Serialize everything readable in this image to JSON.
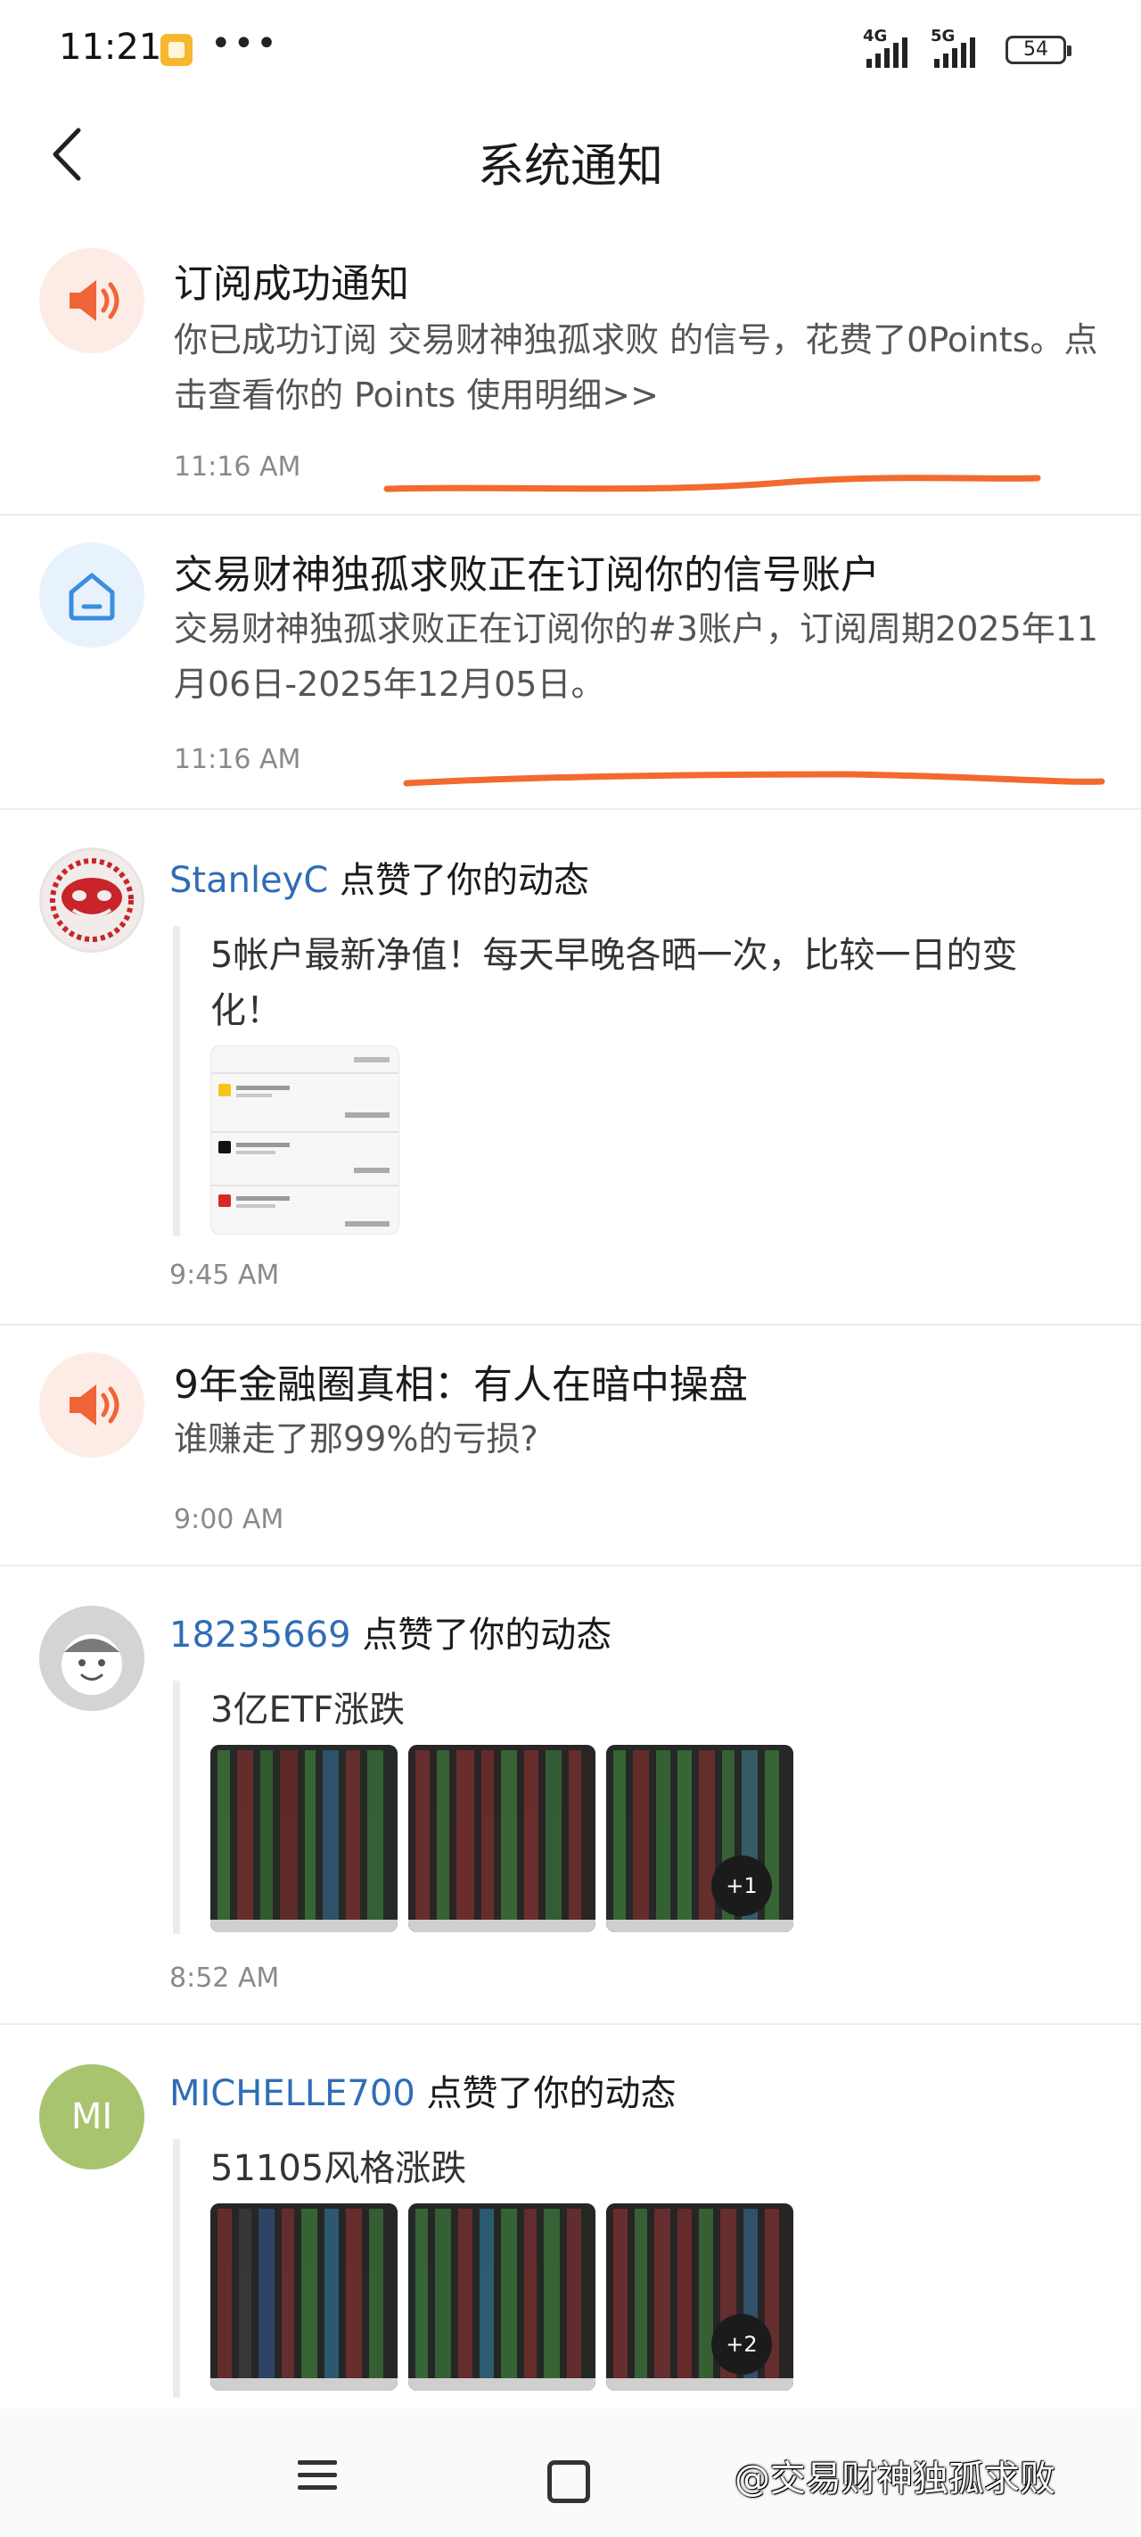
{
  "status_bar": {
    "time": "11:21",
    "dots": "•••",
    "net1": "4G",
    "net2": "5G",
    "battery": "54"
  },
  "header": {
    "title": "系统通知"
  },
  "items": [
    {
      "type": "system",
      "icon": "speaker-icon",
      "title": "订阅成功通知",
      "body": "你已成功订阅 交易财神独孤求败 的信号，花费了0Points。点击查看你的 Points 使用明细>>",
      "time": "11:16 AM"
    },
    {
      "type": "system",
      "icon": "home-icon",
      "title": "交易财神独孤求败正在订阅你的信号账户",
      "body": "交易财神独孤求败正在订阅你的#3账户，订阅周期2025年11月06日-2025年12月05日。",
      "time": "11:16 AM"
    },
    {
      "type": "like",
      "user": "StanleyC",
      "action": "点赞了你的动态",
      "quote": [
        "5帐户最新净值！每天早晚各晒一次，比较一日的变",
        "化！"
      ],
      "time": "9:45 AM"
    },
    {
      "type": "system",
      "icon": "speaker-icon",
      "title": "9年金融圈真相：有人在暗中操盘",
      "body": "谁赚走了那99%的亏损?",
      "time": "9:00 AM"
    },
    {
      "type": "like",
      "user": "18235669",
      "action": "点赞了你的动态",
      "quote": [
        "3亿ETF涨跌"
      ],
      "more": "+1",
      "time": "8:52 AM"
    },
    {
      "type": "like",
      "user": "MICHELLE700",
      "avatar_text": "MI",
      "action": "点赞了你的动态",
      "quote": [
        "51105风格涨跌"
      ],
      "more": "+2"
    }
  ],
  "navbar": {
    "watermark": "@交易财神独孤求败"
  },
  "colors": {
    "accent_orange": "#f0643a",
    "link_blue": "#2f6db5",
    "avatar_green": "#a8c46e"
  }
}
